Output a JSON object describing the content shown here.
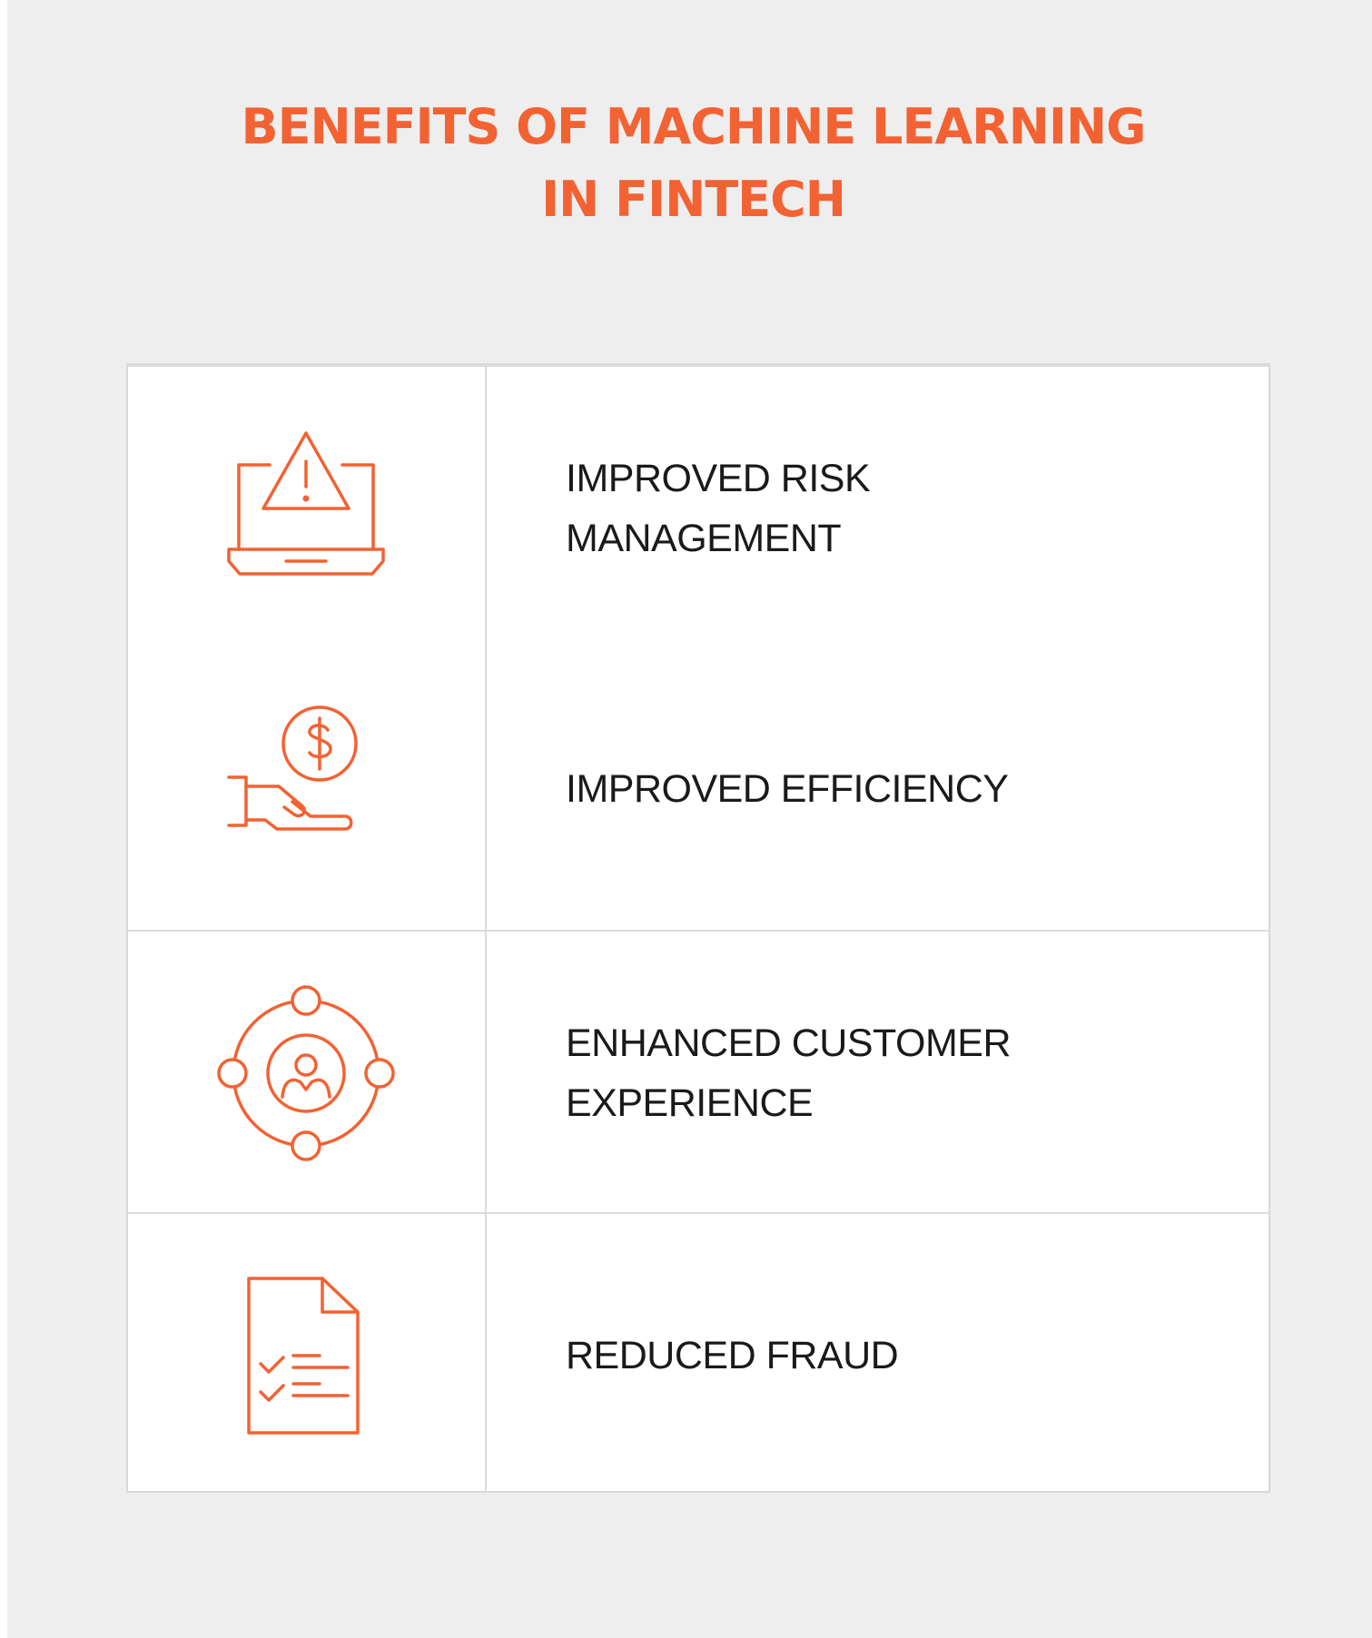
{
  "title": {
    "line1": "BENEFITS OF MACHINE LEARNING",
    "line2": "IN FINTECH"
  },
  "colors": {
    "accent": "#f26232",
    "background": "#eeeeee",
    "card": "#ffffff",
    "text": "#1a1a1a",
    "border": "#d8d8d8"
  },
  "benefits": [
    {
      "icon": "hand-dollar-coin-icon",
      "label": "IMPROVED EFFICIENCY"
    },
    {
      "icon": "customer-orbit-icon",
      "label": "ENHANCED CUSTOMER EXPERIENCE"
    },
    {
      "icon": "document-checklist-icon",
      "label": "REDUCED FRAUD"
    },
    {
      "icon": "laptop-warning-icon",
      "label": "IMPROVED RISK MANAGEMENT"
    }
  ]
}
